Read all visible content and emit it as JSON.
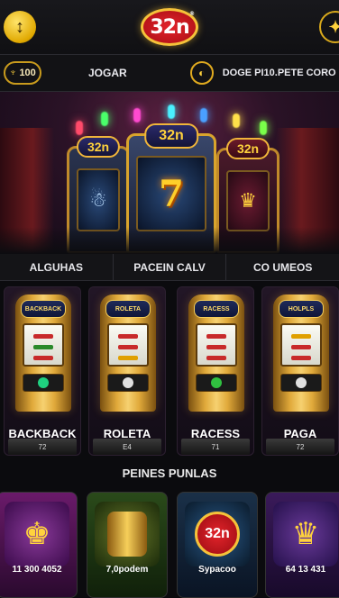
{
  "header": {
    "logo_text": "32n",
    "logo_badge": "®",
    "left_icon": "updown-arrows-icon",
    "right_icon": "sparkle-icon"
  },
  "infobar": {
    "balance": "100",
    "balance_icon": "trophy-icon",
    "play_label": "JOGAR",
    "coin_icon": "coin-icon",
    "deposit_label": "DOGE PI10.PETE CORO"
  },
  "banner": {
    "left_machine_label": "32n",
    "center_machine_label": "32n",
    "center_symbol": "7",
    "right_machine_label": "32n"
  },
  "tabs": [
    {
      "label": "ALGUHAS"
    },
    {
      "label": "PACEIN CALV"
    },
    {
      "label": "CO UMEOS"
    }
  ],
  "slots": [
    {
      "name": "BACKBACK",
      "count": "72",
      "header": "BACKBACK"
    },
    {
      "name": "ROLETA",
      "count": "E4",
      "header": "ROLETA"
    },
    {
      "name": "RACESS",
      "count": "71",
      "header": "RACESS"
    },
    {
      "name": "PAGA",
      "count": "72",
      "header": "HOLPLS"
    }
  ],
  "section": {
    "title": "PEINES PUNLAS"
  },
  "cards": [
    {
      "label": "11 300 4052"
    },
    {
      "label": "7,0podem"
    },
    {
      "label": "Sypacoo",
      "pic_text": "32n"
    },
    {
      "label": "64 13 431"
    }
  ],
  "colors": {
    "accent_gold": "#e0aa1f",
    "brand_red": "#e3242b",
    "background": "#0b0b0e"
  }
}
